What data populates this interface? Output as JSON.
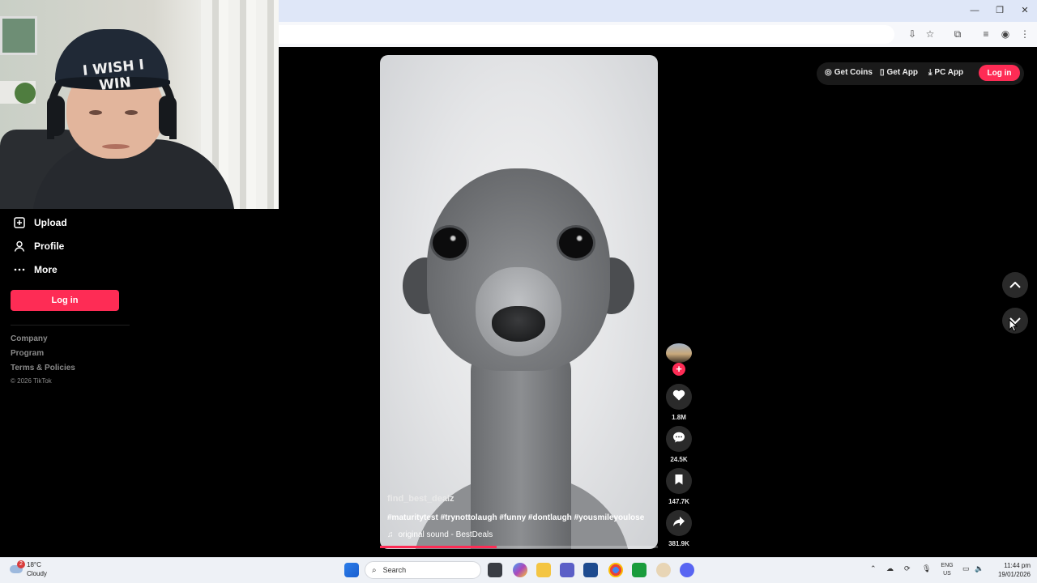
{
  "sidebar": {
    "items": [
      {
        "label": "Upload",
        "icon": "upload-icon"
      },
      {
        "label": "Profile",
        "icon": "profile-icon"
      },
      {
        "label": "More",
        "icon": "more-icon"
      }
    ],
    "login_label": "Log in",
    "footer_links": [
      "Company",
      "Program",
      "Terms & Policies"
    ],
    "copyright": "© 2026 TikTok"
  },
  "webcam": {
    "cap_text": "I WISH I WIN"
  },
  "header": {
    "get_coins": "Get Coins",
    "get_app": "Get App",
    "pc_app": "PC App",
    "login_label": "Log in"
  },
  "video": {
    "username": "find_best_dealz",
    "hashtags": "#maturitytest #trynottolaugh #funny #dontlaugh #yousmileyoulose",
    "sound": "original sound - BestDeals",
    "progress_percent": 42
  },
  "actions": {
    "likes": "1.8M",
    "comments": "24.5K",
    "saves": "147.7K",
    "shares": "381.9K"
  },
  "taskbar": {
    "temperature": "18°C",
    "weather": "Cloudy",
    "weather_badge": "2",
    "search_placeholder": "Search",
    "lang_top": "ENG",
    "lang_bottom": "US",
    "time": "11:44 pm",
    "date": "19/01/2026"
  },
  "colors": {
    "accent": "#fe2c55",
    "background": "#000000",
    "rail_button": "#2a2a2a"
  }
}
